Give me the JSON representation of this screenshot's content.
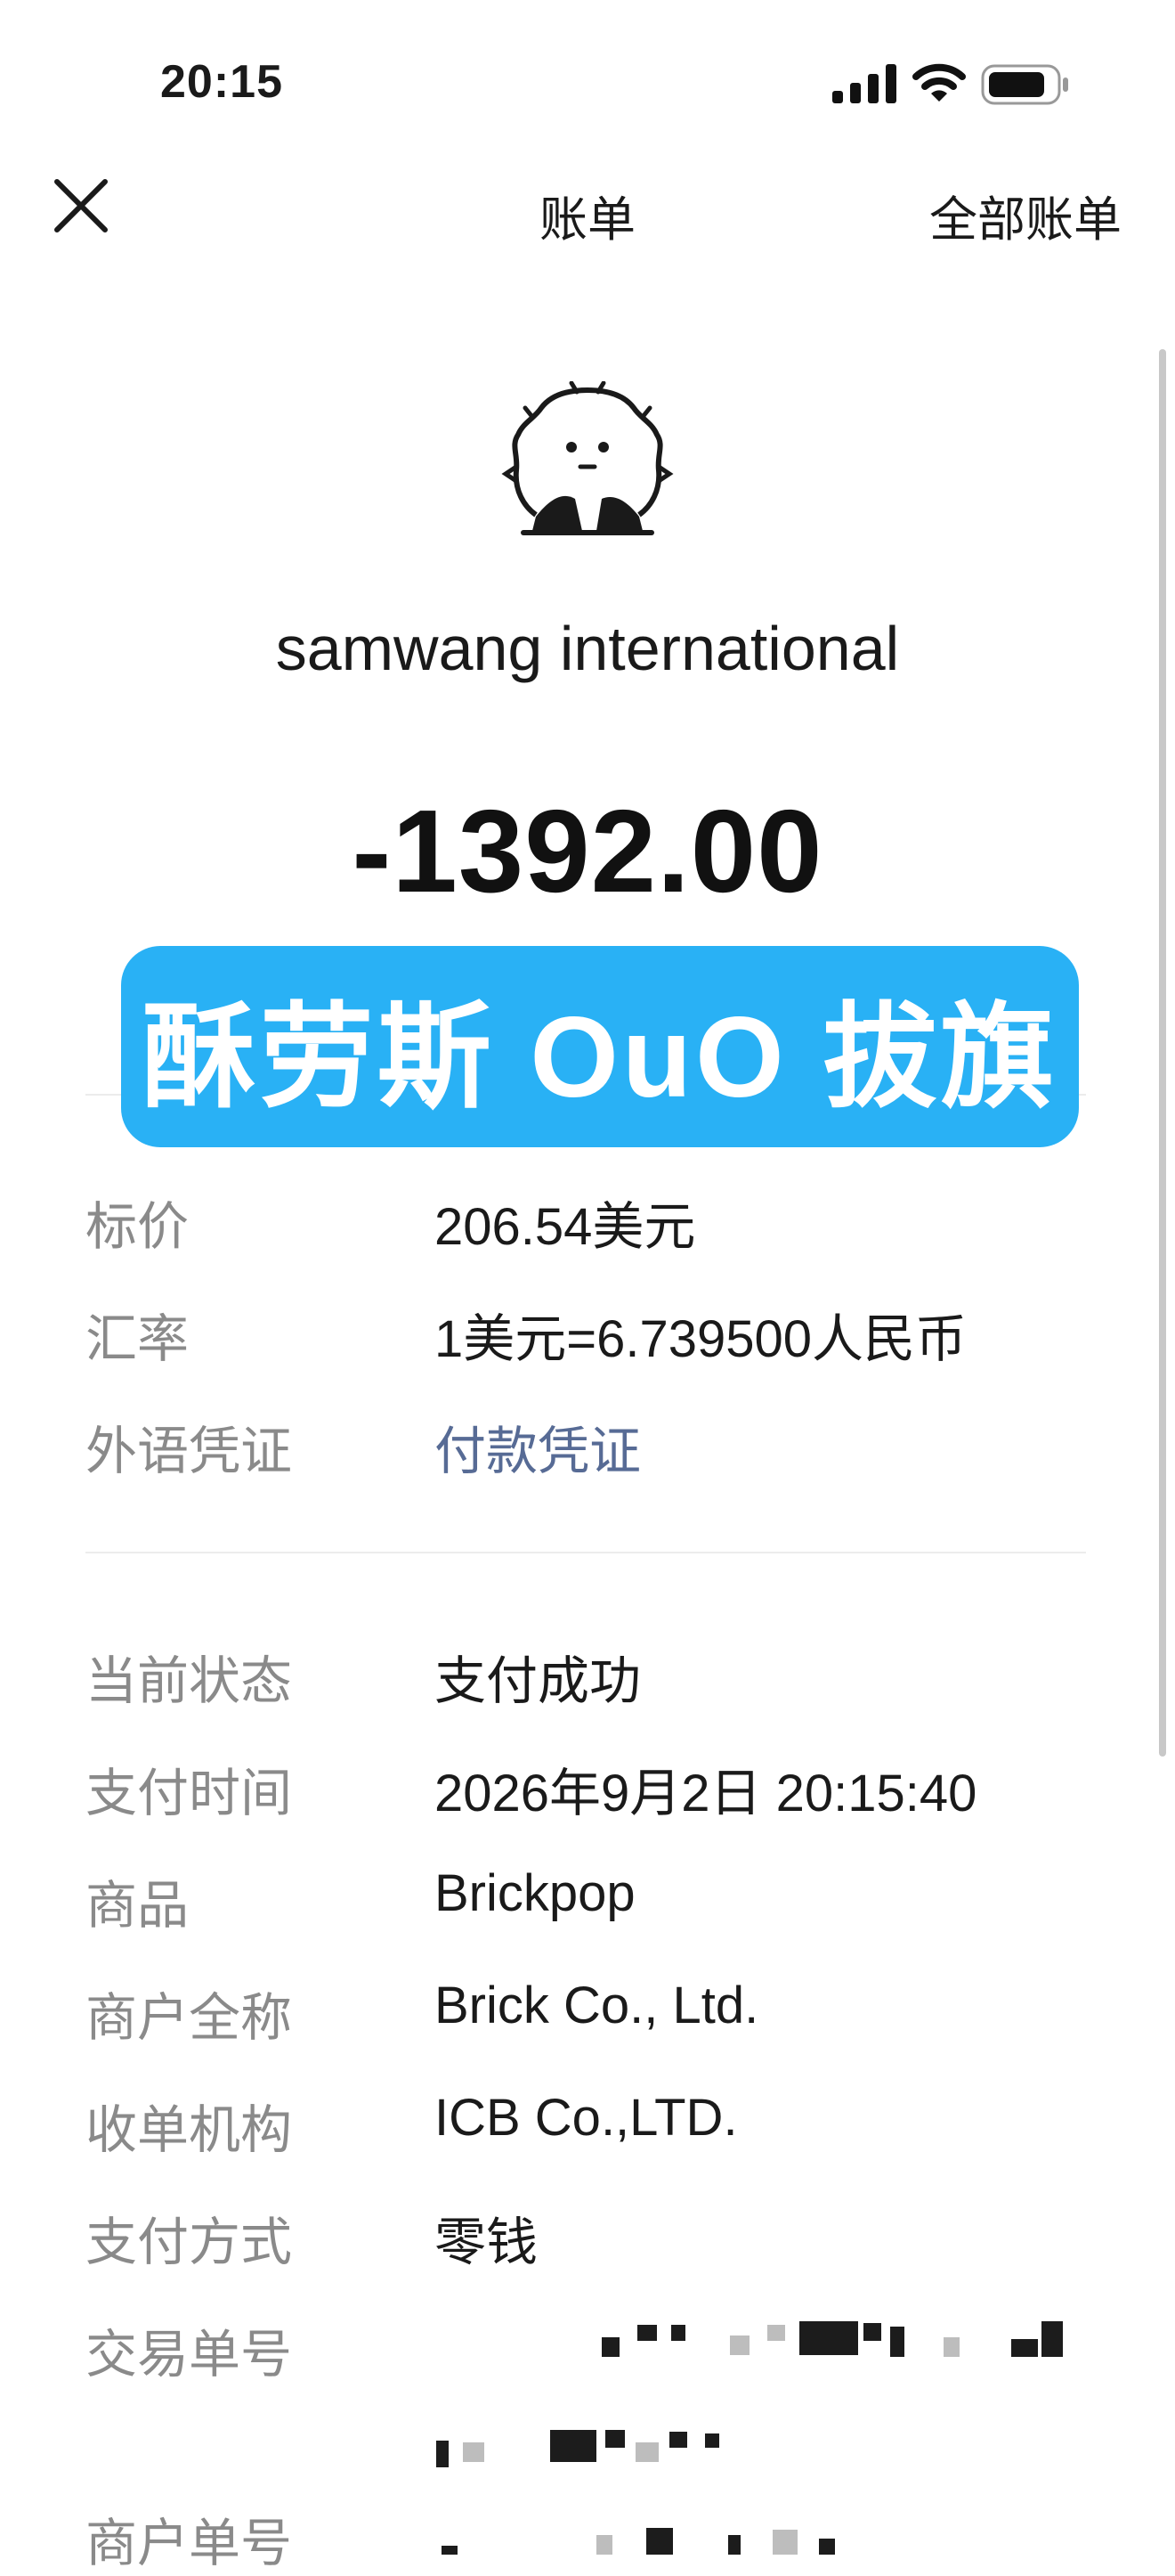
{
  "status_bar": {
    "time": "20:15"
  },
  "nav": {
    "title": "账单",
    "all_bills": "全部账单"
  },
  "merchant": {
    "name": "samwang international"
  },
  "amount": "-1392.00",
  "overlay": {
    "text": "酥劳斯 OuO 拔旗"
  },
  "section1": [
    {
      "label": "标价",
      "value": "206.54美元"
    },
    {
      "label": "汇率",
      "value": "1美元=6.739500人民币"
    },
    {
      "label": "外语凭证",
      "value": "付款凭证"
    }
  ],
  "section2": [
    {
      "label": "当前状态",
      "value": "支付成功"
    },
    {
      "label": "支付时间",
      "value": "2026年9月2日 20:15:40"
    },
    {
      "label": "商品",
      "value": "Brickpop"
    },
    {
      "label": "商户全称",
      "value": "Brick Co., Ltd."
    },
    {
      "label": "收单机构",
      "value": "ICB Co.,LTD."
    },
    {
      "label": "支付方式",
      "value": "零钱"
    },
    {
      "label": "交易单号",
      "value": ""
    },
    {
      "label": "商户单号",
      "value": ""
    }
  ],
  "colors": {
    "link": "#576b95",
    "label": "#8a8a8a",
    "banner": "#29b1f5"
  }
}
